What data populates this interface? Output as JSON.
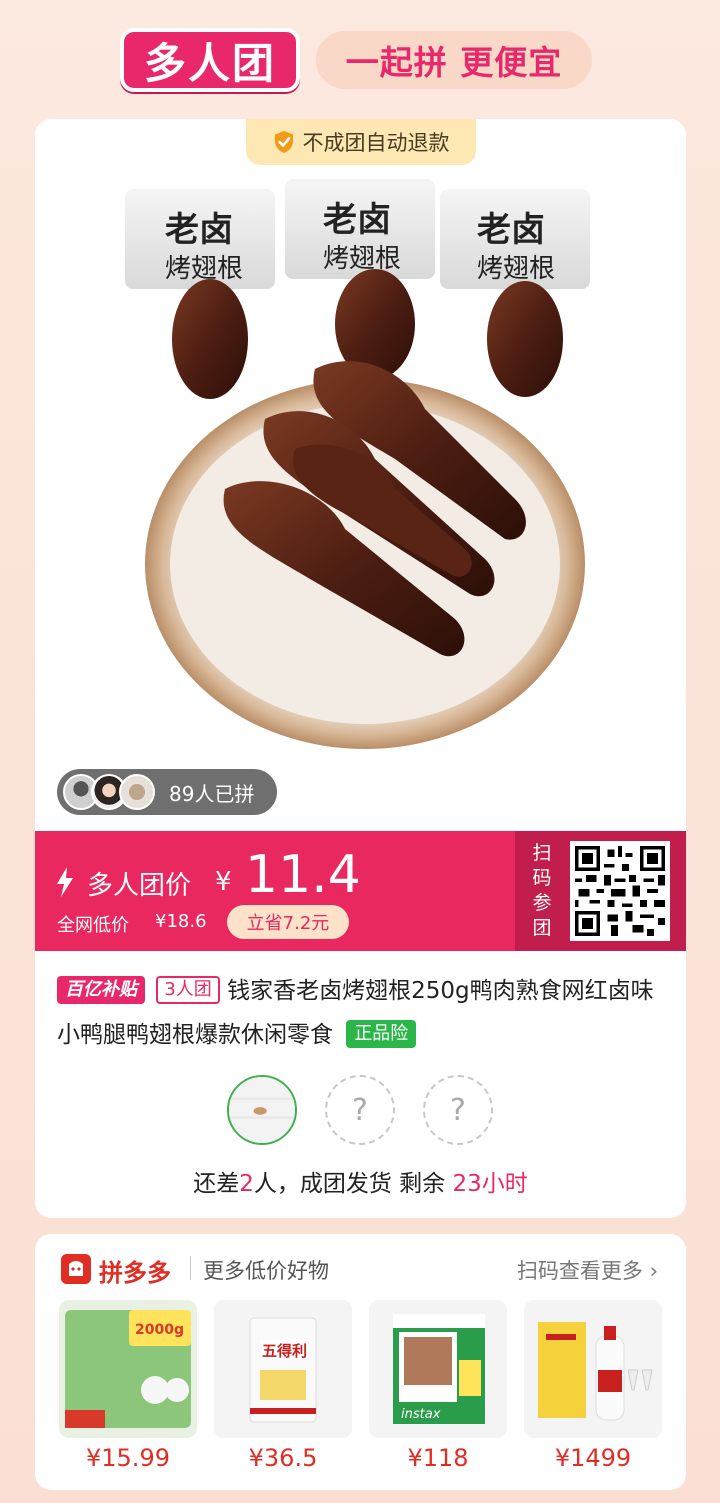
{
  "header": {
    "logo_text": "多人团",
    "slogan": "一起拼 更便宜"
  },
  "product": {
    "refund_tag": "不成团自动退款",
    "joined_count_text": "89人已拼",
    "price_label": "多人团价",
    "currency": "¥",
    "price": "11.4",
    "low_price_label": "全网低价",
    "low_price": "¥18.6",
    "save_text": "立省7.2元",
    "scan_label": "扫码参团",
    "tag_subsidy": "百亿补贴",
    "tag_group": "3人团",
    "title": "钱家香老卤烤翅根250g鸭肉熟食网红卤味小鸭腿鸭翅根爆款休闲零食",
    "tag_genuine": "正品险",
    "slot_placeholder": "?",
    "remain_prefix": "还差",
    "remain_count": "2",
    "remain_middle": "人，成团发货  剩余 ",
    "remain_time": "23小时"
  },
  "recommend": {
    "brand": "拼多多",
    "slogan": "更多低价好物",
    "more": "扫码查看更多 ›",
    "items": [
      {
        "price": "¥15.99",
        "icon": "tissue-pack-icon"
      },
      {
        "price": "¥36.5",
        "icon": "flour-bag-icon"
      },
      {
        "price": "¥118",
        "icon": "instax-film-icon"
      },
      {
        "price": "¥1499",
        "icon": "liquor-bottle-icon"
      }
    ]
  },
  "colors": {
    "accent": "#e8286a",
    "price_bar": "#e8285f",
    "pdd_red": "#e02e24",
    "genuine_green": "#2bb64a"
  }
}
